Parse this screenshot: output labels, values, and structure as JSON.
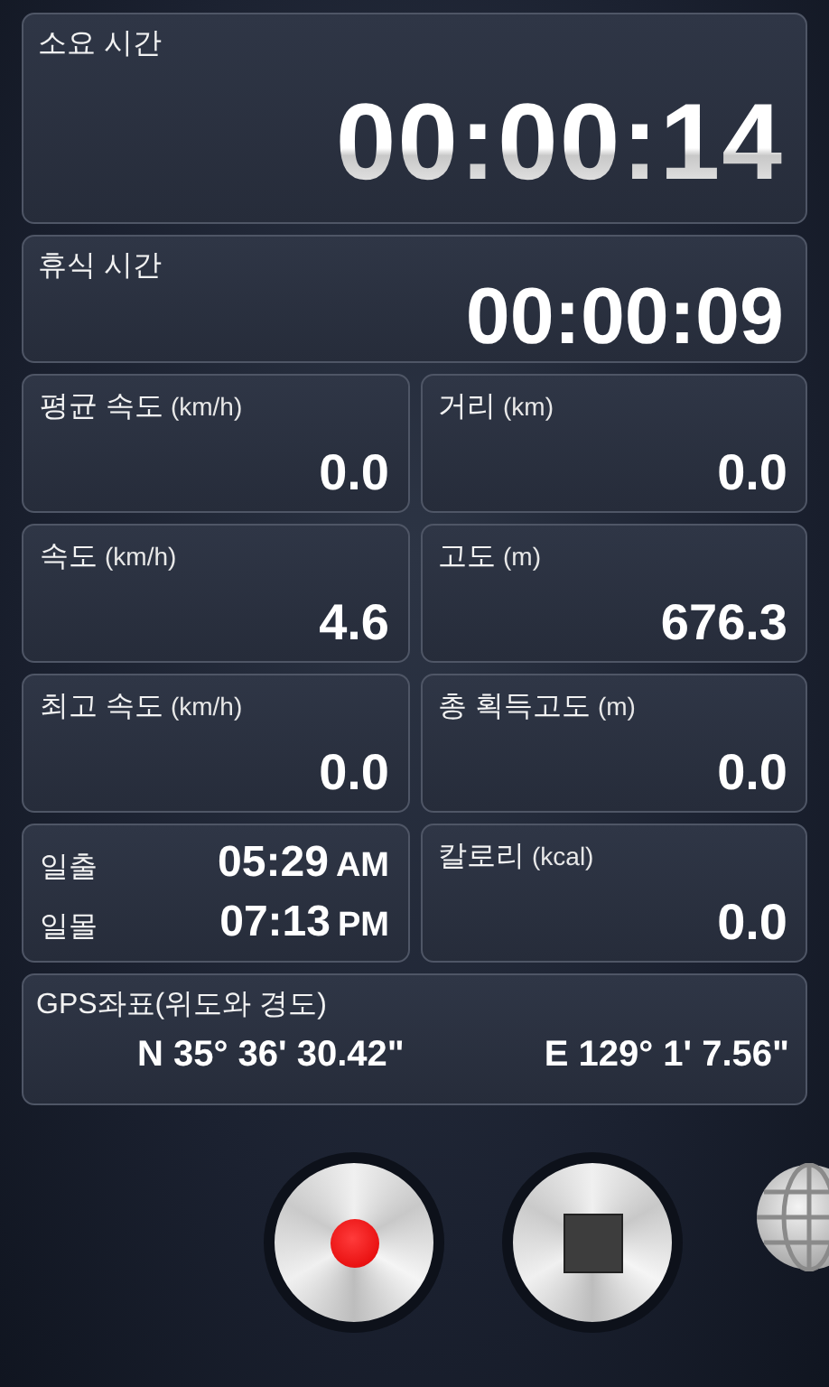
{
  "elapsed": {
    "label": "소요 시간",
    "value": "00:00:14"
  },
  "rest": {
    "label": "휴식 시간",
    "value": "00:00:09"
  },
  "cells": [
    {
      "kind": "stat",
      "label": "평균 속도",
      "unit": "(km/h)",
      "value": "0.0"
    },
    {
      "kind": "stat",
      "label": "거리",
      "unit": "(km)",
      "value": "0.0"
    },
    {
      "kind": "stat",
      "label": "속도",
      "unit": "(km/h)",
      "value": "4.6"
    },
    {
      "kind": "stat",
      "label": "고도",
      "unit": "(m)",
      "value": "676.3"
    },
    {
      "kind": "stat",
      "label": "최고 속도",
      "unit": "(km/h)",
      "value": "0.0"
    },
    {
      "kind": "stat",
      "label": "총 획득고도",
      "unit": "(m)",
      "value": "0.0"
    },
    {
      "kind": "sun",
      "rows": [
        {
          "label": "일출",
          "time": "05:29",
          "period": "AM"
        },
        {
          "label": "일몰",
          "time": "07:13",
          "period": "PM"
        }
      ]
    },
    {
      "kind": "stat",
      "label": "칼로리",
      "unit": "(kcal)",
      "value": "0.0"
    }
  ],
  "gps": {
    "label": "GPS좌표(위도와 경도)",
    "latitude": "N 35° 36' 30.42\"",
    "longitude": "E 129° 1' 7.56\""
  },
  "buttons": [
    {
      "kind": "record"
    },
    {
      "kind": "stop"
    },
    {
      "kind": "globe"
    }
  ]
}
